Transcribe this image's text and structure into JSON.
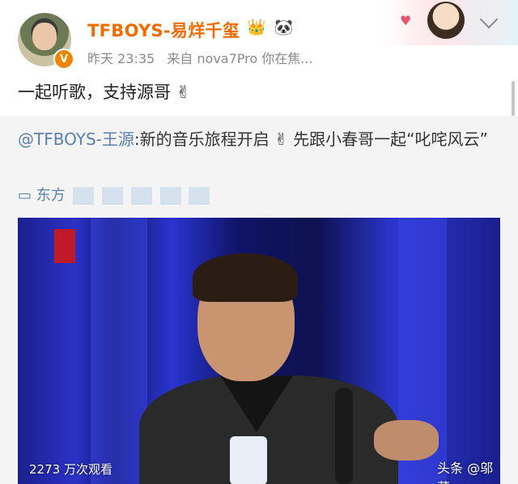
{
  "author": {
    "name": "TFBOYS-易烊千玺",
    "verified_badge": "V",
    "badge_icons": [
      "👑",
      "🐼"
    ]
  },
  "meta": {
    "time": "昨天 23:35",
    "source": "来自 nova7Pro 你在焦..."
  },
  "post": {
    "text": "一起听歌，支持源哥 ✌"
  },
  "repost": {
    "mention": "@TFBOYS-王源",
    "text": ":新的音乐旅程开启 ✌ 先跟小春哥一起“叱咤风云”",
    "link_label": "东方"
  },
  "video": {
    "views": "2273 万次观看",
    "watermark": "头条 @邬董"
  },
  "colors": {
    "username": "#f06b00",
    "link": "#5b7fb0",
    "repost_bg": "#f4f4f4"
  }
}
